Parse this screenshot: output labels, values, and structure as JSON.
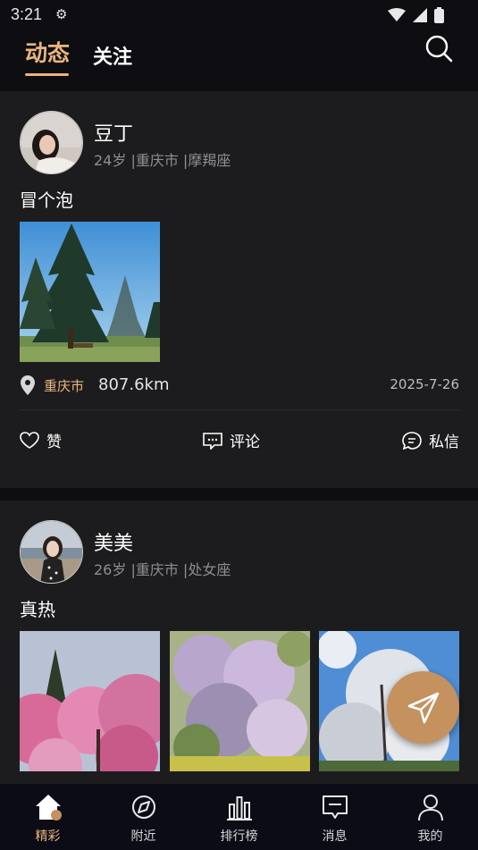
{
  "status_bar": {
    "time": "3:21"
  },
  "header": {
    "tabs": [
      {
        "label": "动态",
        "active": true
      },
      {
        "label": "关注",
        "active": false
      }
    ]
  },
  "posts": [
    {
      "user": {
        "name": "豆丁",
        "meta": "24岁 |重庆市 |摩羯座"
      },
      "text": "冒个泡",
      "location": {
        "city": "重庆市",
        "distance": "807.6km"
      },
      "date": "2025-7-26",
      "actions": {
        "like": "赞",
        "comment": "评论",
        "message": "私信"
      }
    },
    {
      "user": {
        "name": "美美",
        "meta": "26岁 |重庆市 |处女座"
      },
      "text": "真热"
    }
  ],
  "bottom_nav": [
    {
      "label": "精彩",
      "icon": "home-icon",
      "active": true
    },
    {
      "label": "附近",
      "icon": "nearby-icon",
      "active": false
    },
    {
      "label": "排行榜",
      "icon": "ranking-icon",
      "active": false
    },
    {
      "label": "消息",
      "icon": "message-icon",
      "active": false
    },
    {
      "label": "我的",
      "icon": "profile-icon",
      "active": false
    }
  ],
  "colors": {
    "accent": "#e9b57e",
    "card": "#1c1c1e",
    "background": "#0d0d12",
    "fab": "#c4915f"
  }
}
